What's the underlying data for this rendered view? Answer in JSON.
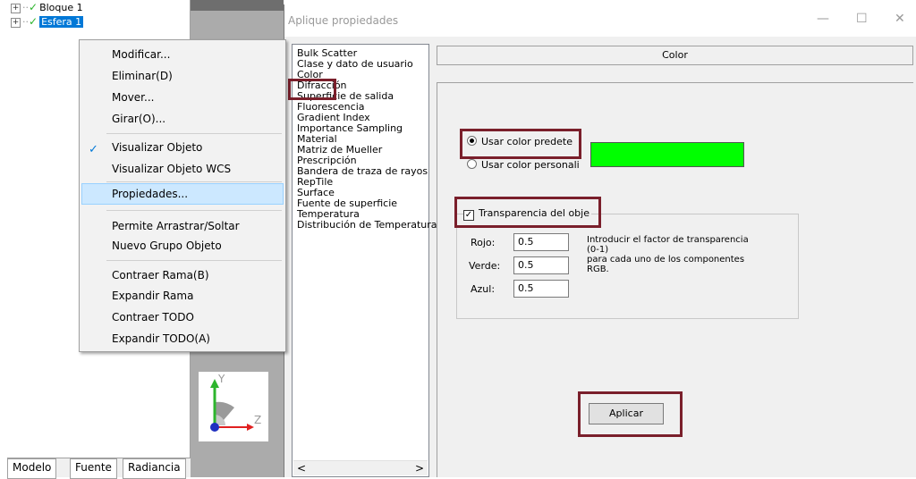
{
  "tree": {
    "items": [
      {
        "expander": "+",
        "label": "Bloque 1",
        "selected": false
      },
      {
        "expander": "+",
        "label": "Esfera 1",
        "selected": true
      }
    ],
    "tabs": [
      "Modelo",
      "Fuente",
      "Radiancia"
    ]
  },
  "context_menu": {
    "groups": [
      [
        "Modificar...",
        "Eliminar(D)",
        "Mover...",
        "Girar(O)..."
      ],
      [
        "Visualizar Objeto",
        "Visualizar Objeto WCS"
      ],
      [
        "Propiedades..."
      ],
      [
        "Permite Arrastrar/Soltar",
        "Nuevo Grupo Objeto"
      ],
      [
        "Contraer Rama(B)",
        "Expandir Rama",
        "Contraer TODO",
        "Expandir TODO(A)"
      ]
    ],
    "checked_item": "Visualizar Objeto",
    "highlighted_item": "Propiedades..."
  },
  "axes": {
    "y": "Y",
    "z": "Z"
  },
  "dialog": {
    "title": "Aplique propiedades",
    "controls": {
      "minimize": "—",
      "maximize": "☐",
      "close": "✕"
    },
    "property_list": [
      "Bulk Scatter",
      "Clase y dato de usuario",
      "Color",
      "Difracción",
      "Superficie de salida",
      "Fluorescencia",
      "Gradient Index",
      "Importance Sampling",
      "Material",
      "Matriz de Mueller",
      "Prescripción",
      "Bandera de traza de rayos",
      "RepTile",
      "Surface",
      "Fuente de superficie",
      "Temperatura",
      "Distribución de Temperatura"
    ],
    "selected_property": "Color",
    "scroll": {
      "left": "<",
      "right": ">"
    },
    "panel_header": "Color",
    "color_options": {
      "default_label": "Usar color predete",
      "custom_label": "Usar color personali",
      "selected": "default",
      "swatch_color": "#00ff00"
    },
    "transparency": {
      "checkbox_label": "Transparencia del obje",
      "checked": true,
      "fields": [
        {
          "label": "Rojo:",
          "value": "0.5"
        },
        {
          "label": "Verde:",
          "value": "0.5"
        },
        {
          "label": "Azul:",
          "value": "0.5"
        }
      ],
      "note_line1": "Introducir el factor de transparencia",
      "note_line2": "(0-1)",
      "note_line3": "para cada uno de los componentes",
      "note_line4": "RGB."
    },
    "apply_label": "Aplicar"
  },
  "colors": {
    "highlight_box": "#7a1f2b",
    "selection": "#0078d7"
  }
}
